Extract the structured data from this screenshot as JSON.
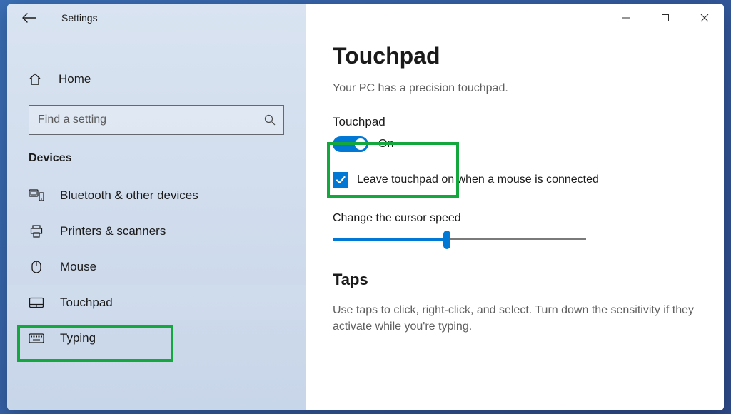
{
  "window": {
    "title": "Settings",
    "home_label": "Home",
    "search_placeholder": "Find a setting",
    "category_label": "Devices",
    "sidebar_items": [
      {
        "label": "Bluetooth & other devices"
      },
      {
        "label": "Printers & scanners"
      },
      {
        "label": "Mouse"
      },
      {
        "label": "Touchpad"
      },
      {
        "label": "Typing"
      }
    ]
  },
  "content": {
    "page_title": "Touchpad",
    "subtitle": "Your PC has a precision touchpad.",
    "toggle": {
      "label": "Touchpad",
      "state_label": "On",
      "on": true
    },
    "checkbox": {
      "checked": true,
      "label": "Leave touchpad on when a mouse is connected"
    },
    "cursor_speed": {
      "label": "Change the cursor speed",
      "percent": 45
    },
    "taps": {
      "heading": "Taps",
      "desc": "Use taps to click, right-click, and select. Turn down the sensitivity if they activate while you're typing."
    }
  }
}
